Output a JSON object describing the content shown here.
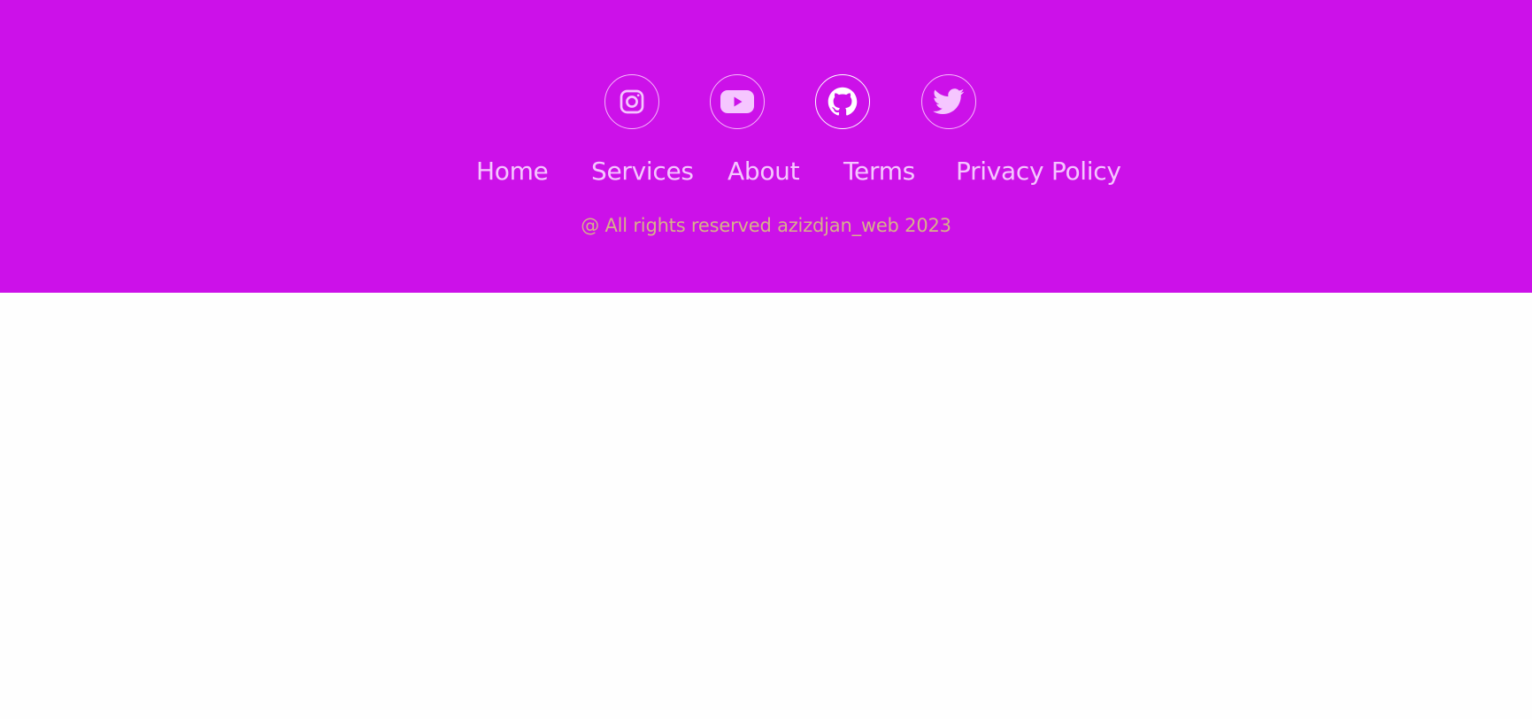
{
  "footer": {
    "background": "#cc11e9",
    "social": [
      {
        "icon": "instagram-icon"
      },
      {
        "icon": "youtube-icon"
      },
      {
        "icon": "github-icon"
      },
      {
        "icon": "twitter-icon"
      }
    ],
    "nav": [
      {
        "label": "Home"
      },
      {
        "label": "Services"
      },
      {
        "label": "About"
      },
      {
        "label": "Terms"
      },
      {
        "label": "Privacy Policy"
      }
    ],
    "copyright": "@ All rights reserved azizdjan_web 2023",
    "colors": {
      "link": "#f5c6ff",
      "copyright": "#d6b18a",
      "icon": "#f5c6ff",
      "page_background": "#fefefe"
    }
  }
}
